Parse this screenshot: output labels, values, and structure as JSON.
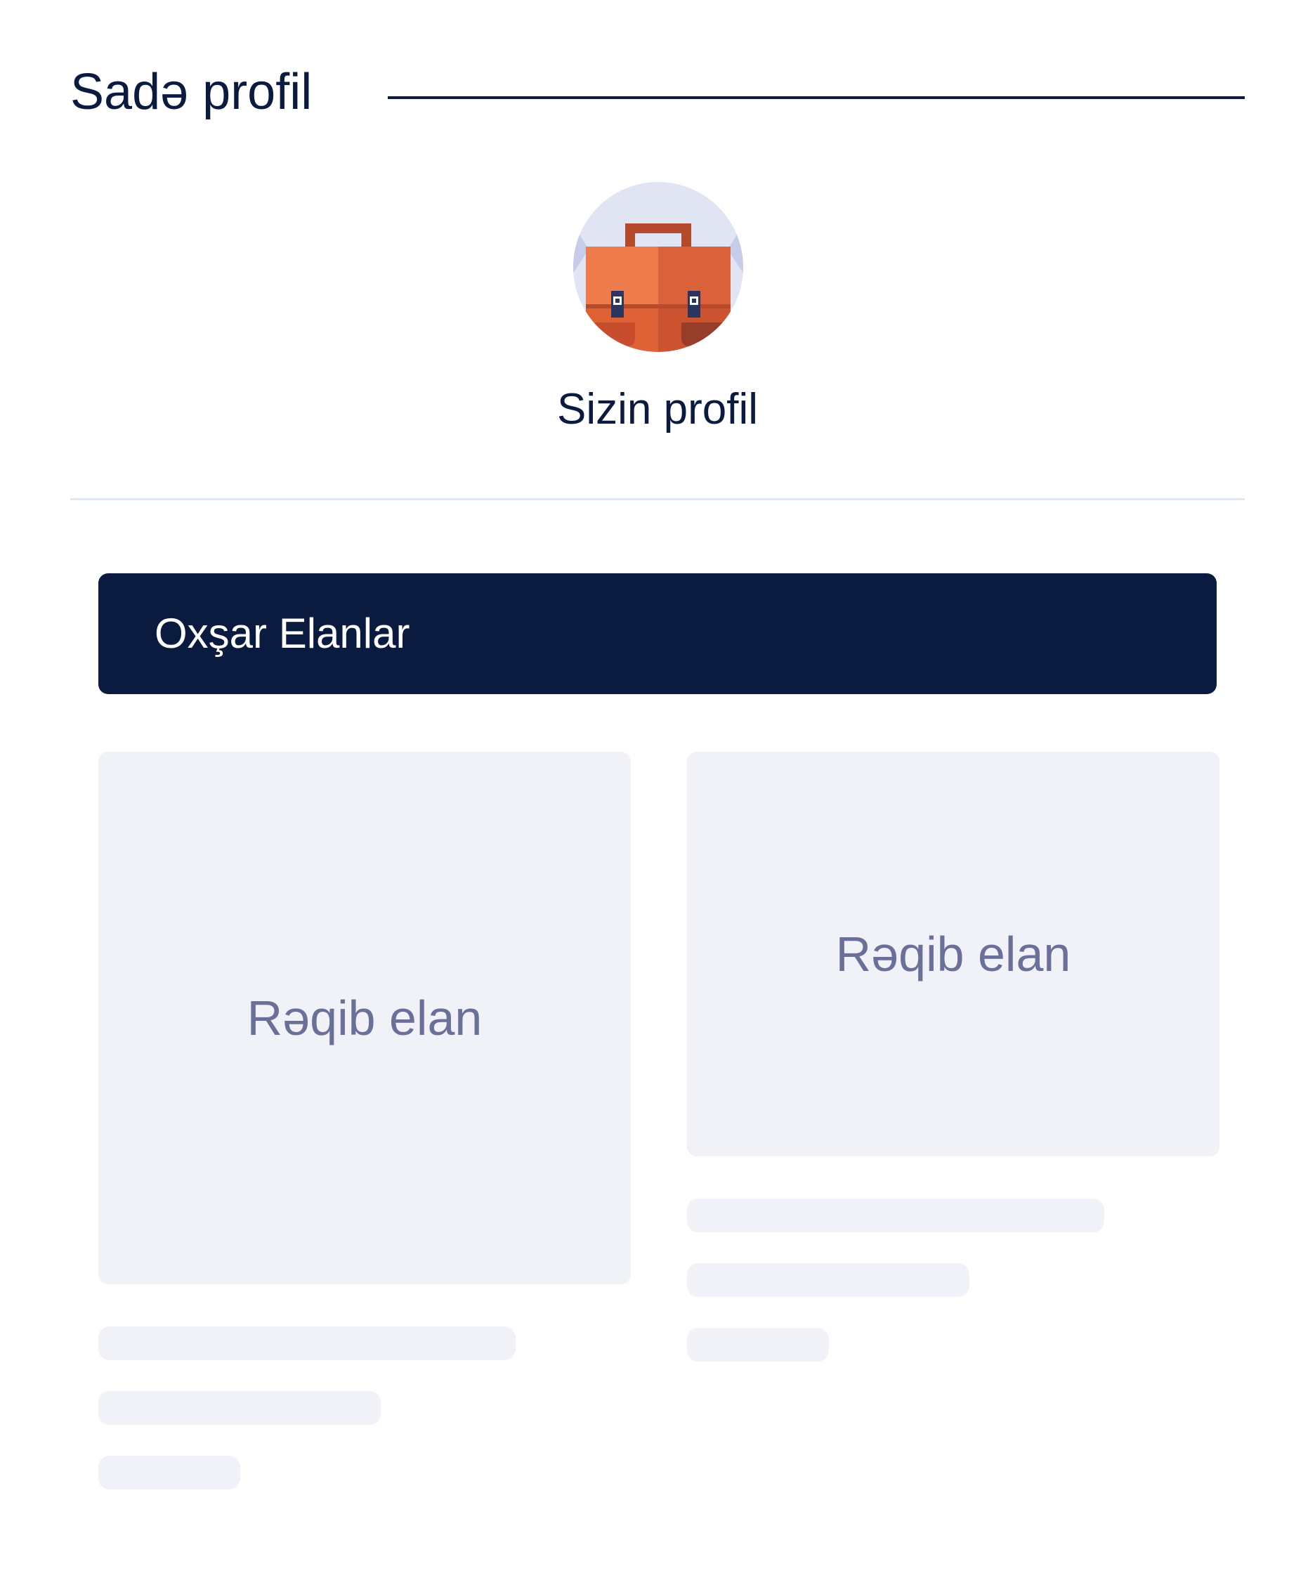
{
  "header": {
    "title": "Sadə profil"
  },
  "profile": {
    "avatar_icon": "briefcase-icon",
    "name": "Sizin profil"
  },
  "similar_listings": {
    "title": "Oxşar Elanlar",
    "cards": [
      {
        "image_label": "Rəqib elan"
      },
      {
        "image_label": "Rəqib elan"
      }
    ]
  },
  "colors": {
    "navy": "#0a1b3f",
    "card_bg": "#f1f2f7",
    "placeholder_text": "#6a7099",
    "divider": "#dce7f8",
    "briefcase_orange": "#ed7846"
  }
}
